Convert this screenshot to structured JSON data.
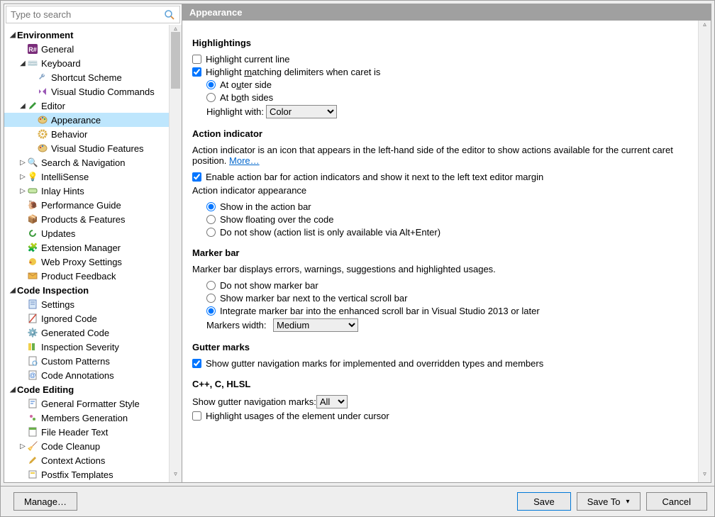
{
  "search": {
    "placeholder": "Type to search"
  },
  "header": {
    "title": "Appearance"
  },
  "tree": {
    "environment": {
      "label": "Environment",
      "general": "General",
      "keyboard": "Keyboard",
      "shortcut": "Shortcut Scheme",
      "vscmd": "Visual Studio Commands",
      "editor": "Editor",
      "appearance": "Appearance",
      "behavior": "Behavior",
      "vsfeat": "Visual Studio Features",
      "searchnav": "Search & Navigation",
      "intelli": "IntelliSense",
      "inlay": "Inlay Hints",
      "perf": "Performance Guide",
      "prodfeat": "Products & Features",
      "updates": "Updates",
      "extmgr": "Extension Manager",
      "webproxy": "Web Proxy Settings",
      "feedback": "Product Feedback"
    },
    "inspection": {
      "label": "Code Inspection",
      "settings": "Settings",
      "ignored": "Ignored Code",
      "generated": "Generated Code",
      "severity": "Inspection Severity",
      "patterns": "Custom Patterns",
      "annot": "Code Annotations"
    },
    "editing": {
      "label": "Code Editing",
      "fmt": "General Formatter Style",
      "members": "Members Generation",
      "fileheader": "File Header Text",
      "cleanup": "Code Cleanup",
      "ctxact": "Context Actions",
      "postfix": "Postfix Templates"
    }
  },
  "highlightings": {
    "title": "Highlightings",
    "current_line": "Highlight current line",
    "matching": "Highlight matching delimiters when caret is",
    "outer": "At outer side",
    "both": "At both sides",
    "with_label": "Highlight with:",
    "with_value": "Color"
  },
  "action": {
    "title": "Action indicator",
    "desc": "Action indicator is an icon that appears in the left-hand side of the editor to show actions available for the current caret position.",
    "more": "More…",
    "enable": "Enable action bar for action indicators and show it next to the left text editor margin",
    "appearance_label": "Action indicator appearance",
    "show_bar": "Show in the action bar",
    "show_float": "Show floating over the code",
    "donot": "Do not show (action list is only available via Alt+Enter)"
  },
  "marker": {
    "title": "Marker bar",
    "desc": "Marker bar displays errors, warnings, suggestions and highlighted usages.",
    "donot": "Do not show marker bar",
    "next": "Show marker bar next to the vertical scroll bar",
    "integrate": "Integrate marker bar into the enhanced scroll bar in Visual Studio 2013 or later",
    "width_label": "Markers width:",
    "width_value": "Medium"
  },
  "gutter": {
    "title": "Gutter marks",
    "show": "Show gutter navigation marks for implemented and overridden types and members"
  },
  "cpp": {
    "title": "C++, C, HLSL",
    "nav_label": "Show gutter navigation marks:",
    "nav_value": "All",
    "hl_usages": "Highlight usages of the element under cursor"
  },
  "footer": {
    "manage": "Manage…",
    "save": "Save",
    "saveto": "Save To",
    "cancel": "Cancel"
  }
}
